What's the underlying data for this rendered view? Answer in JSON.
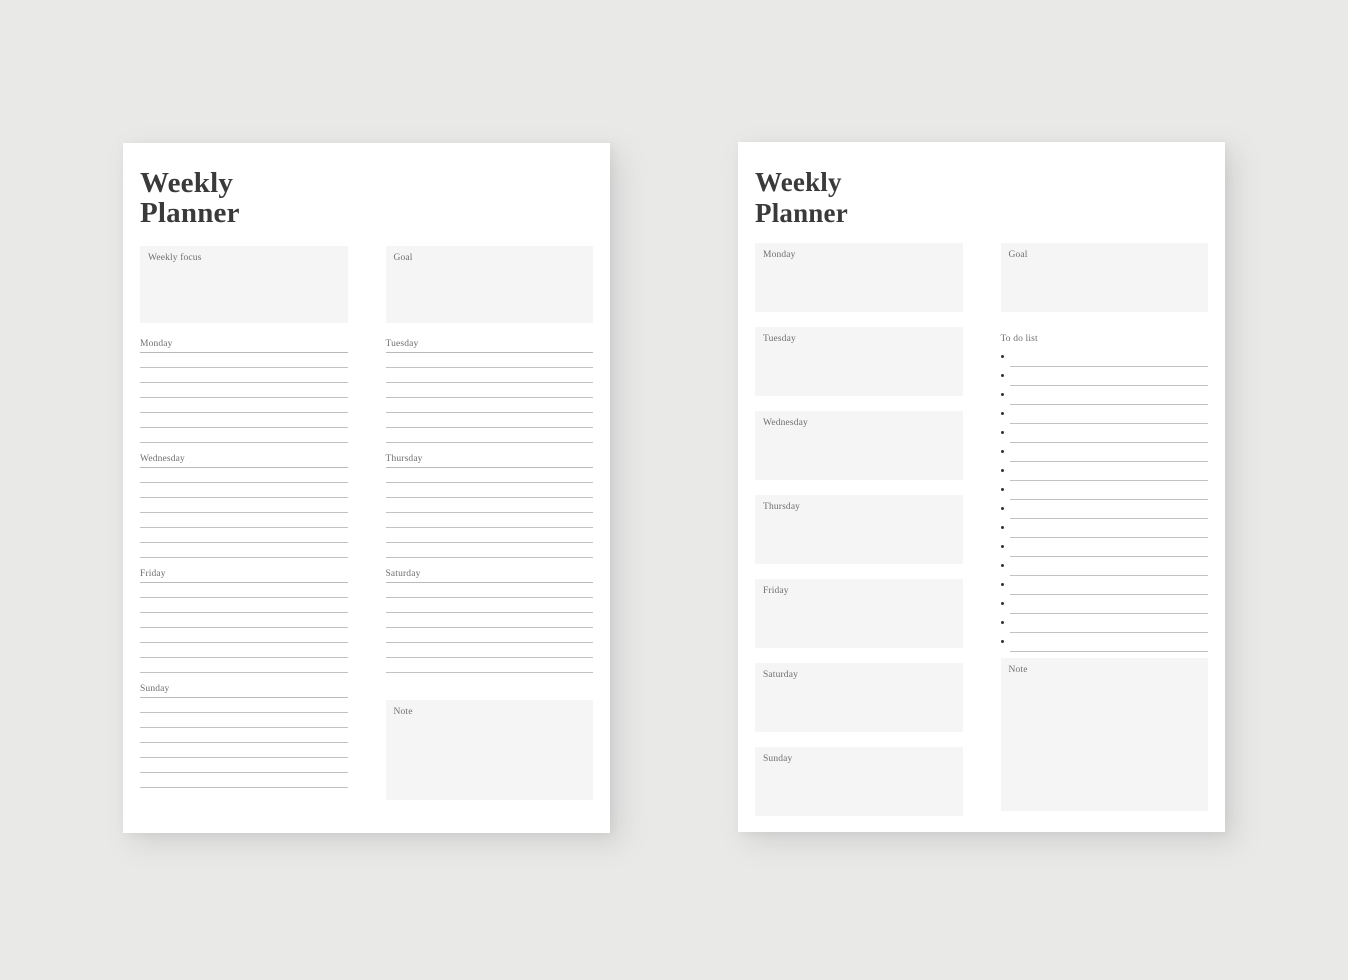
{
  "background_color": "#e9e9e8",
  "page_color": "#ffffff",
  "box_fill_color": "#f5f5f5",
  "rule_color": "#c2c2c2",
  "label_color": "#6f6f6f",
  "title_color": "#3a3a3a",
  "left_page": {
    "title": {
      "line1": "Weekly",
      "line2": "Planner"
    },
    "weekly_focus_label": "Weekly focus",
    "goal_label": "Goal",
    "note_label": "Note",
    "days": [
      {
        "label": "Monday",
        "lines": 6
      },
      {
        "label": "Tuesday",
        "lines": 6
      },
      {
        "label": "Wednesday",
        "lines": 6
      },
      {
        "label": "Thursday",
        "lines": 6
      },
      {
        "label": "Friday",
        "lines": 6
      },
      {
        "label": "Saturday",
        "lines": 6
      },
      {
        "label": "Sunday",
        "lines": 6
      }
    ]
  },
  "right_page": {
    "title": {
      "line1": "Weekly",
      "line2": "Planner"
    },
    "goal_label": "Goal",
    "note_label": "Note",
    "todo_label": "To do list",
    "todo_rows": 16,
    "days": [
      {
        "label": "Monday"
      },
      {
        "label": "Tuesday"
      },
      {
        "label": "Wednesday"
      },
      {
        "label": "Thursday"
      },
      {
        "label": "Friday"
      },
      {
        "label": "Saturday"
      },
      {
        "label": "Sunday"
      }
    ]
  }
}
